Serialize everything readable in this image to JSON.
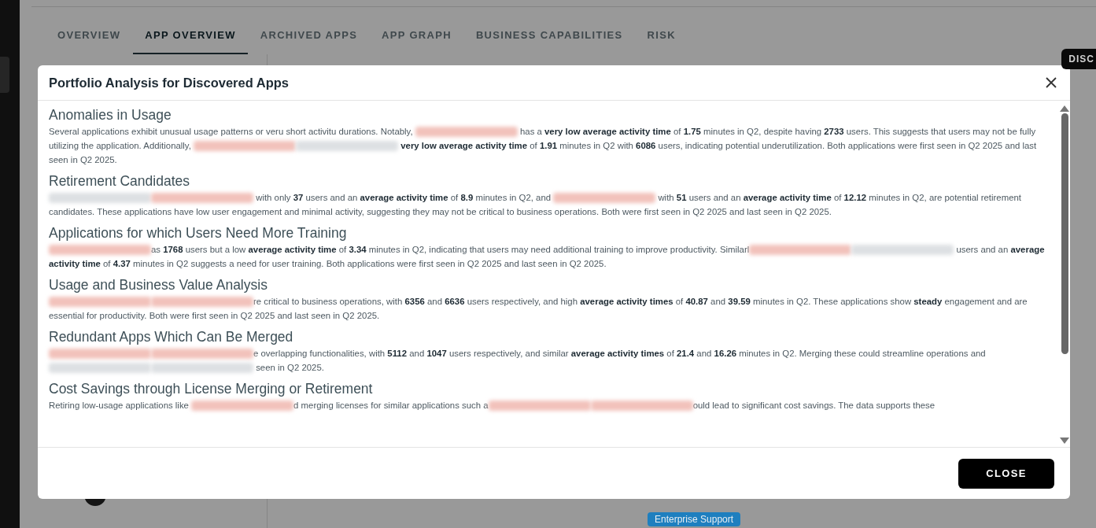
{
  "tabs": [
    {
      "label": "OVERVIEW",
      "selected": false
    },
    {
      "label": "APP OVERVIEW",
      "selected": true
    },
    {
      "label": "ARCHIVED APPS",
      "selected": false
    },
    {
      "label": "APP GRAPH",
      "selected": false
    },
    {
      "label": "BUSINESS CAPABILITIES",
      "selected": false
    },
    {
      "label": "RISK",
      "selected": false
    }
  ],
  "corner_chip": "DISC",
  "tags": [
    {
      "label": "Enterprise Support",
      "color": "#1e7fbf"
    }
  ],
  "dialog": {
    "title": "Portfolio Analysis for Discovered Apps",
    "sections": [
      {
        "heading": "Anomalies in Usage",
        "parts": [
          {
            "kind": "text",
            "text": "Several applications exhibit unusual usage patterns or veru short activitu durations. Notably, "
          },
          {
            "kind": "redacted"
          },
          {
            "kind": "text",
            "text": " has a **very low average activity time** of **1.75** minutes in Q2, despite having **2733** users. This suggests that users may not be fully utilizing the application. Additionally, "
          },
          {
            "kind": "redacted"
          },
          {
            "kind": "blurred"
          },
          {
            "kind": "text",
            "text": " **very low average activity time** of **1.91** minutes in Q2 with **6086** users, indicating potential underutilization. Both applications were first seen in Q2 2025 and last seen in Q2 2025."
          }
        ]
      },
      {
        "heading": "Retirement Candidates",
        "parts": [
          {
            "kind": "blurred"
          },
          {
            "kind": "redacted"
          },
          {
            "kind": "text",
            "text": " with only **37** users and an **average activity time** of **8.9** minutes in Q2, and "
          },
          {
            "kind": "redacted"
          },
          {
            "kind": "text",
            "text": " with **51** users and an **average activity time** of **12.12** minutes in Q2, are potential retirement candidates. These applications have low user engagement and minimal activity, suggesting they may not be critical to business operations. Both were first seen in Q2 2025 and last seen in Q2 2025."
          }
        ]
      },
      {
        "heading": "Applications for which Users Need More Training",
        "parts": [
          {
            "kind": "redacted"
          },
          {
            "kind": "text",
            "text": "as **1768** users but a low **average activity time** of **3.34** minutes in Q2, indicating that users may need additional training to improve productivity. Similarl"
          },
          {
            "kind": "redacted"
          },
          {
            "kind": "blurred"
          },
          {
            "kind": "text",
            "text": " users and an **average activity time** of **4.37** minutes in Q2 suggests a need for user training. Both applications were first seen in Q2 2025 and last seen in Q2 2025."
          }
        ]
      },
      {
        "heading": "Usage and Business Value Analysis",
        "parts": [
          {
            "kind": "redacted"
          },
          {
            "kind": "redacted"
          },
          {
            "kind": "text",
            "text": "re critical to business operations, with **6356** and **6636** users respectively, and high **average activity times** of **40.87** and **39.59** minutes in Q2. These applications show **steady** engagement and are essential for productivity. Both were first seen in Q2 2025 and last seen in Q2 2025."
          }
        ]
      },
      {
        "heading": "Redundant Apps Which Can Be Merged",
        "parts": [
          {
            "kind": "redacted"
          },
          {
            "kind": "redacted"
          },
          {
            "kind": "text",
            "text": "e overlapping functionalities, with **5112** and **1047** users respectively, and similar **average activity times** of **21.4** and **16.26** minutes in Q2. Merging these could streamline operations and "
          },
          {
            "kind": "blurred"
          },
          {
            "kind": "blurred"
          },
          {
            "kind": "text",
            "text": " seen in Q2 2025."
          }
        ]
      },
      {
        "heading": "Cost Savings through License Merging or Retirement",
        "parts": [
          {
            "kind": "text",
            "text": "Retiring low-usage applications like "
          },
          {
            "kind": "redacted"
          },
          {
            "kind": "text",
            "text": "d merging licenses for similar applications such a"
          },
          {
            "kind": "redacted"
          },
          {
            "kind": "redacted"
          },
          {
            "kind": "text",
            "text": "ould lead to significant cost savings. The data supports these"
          }
        ]
      }
    ],
    "close_button": "CLOSE"
  }
}
